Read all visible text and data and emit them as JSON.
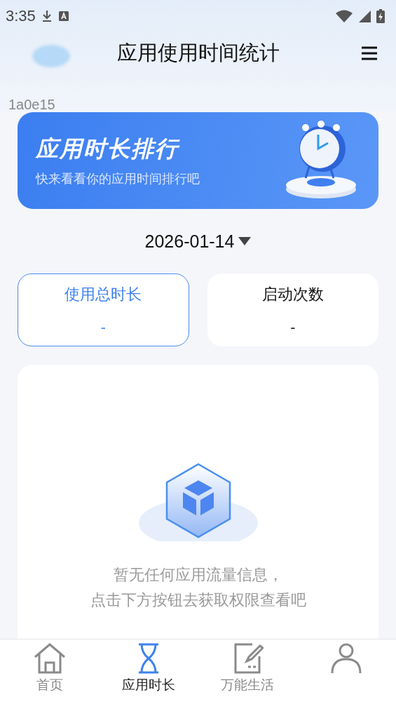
{
  "status_bar": {
    "time": "3:35"
  },
  "header": {
    "title": "应用使用时间统计",
    "debug_label": "1a0e15"
  },
  "banner": {
    "title": "应用时长排行",
    "subtitle": "快来看看你的应用时间排行吧"
  },
  "date": {
    "value": "2026-01-14"
  },
  "stat_tabs": [
    {
      "label": "使用总时长",
      "value": "-",
      "selected": true
    },
    {
      "label": "启动次数",
      "value": "-",
      "selected": false
    }
  ],
  "empty_state": {
    "lines": [
      "暂无任何应用流量信息，",
      "点击下方按钮去获取权限查看吧"
    ]
  },
  "bottom_nav": [
    {
      "label": "首页",
      "selected": false
    },
    {
      "label": "应用时长",
      "selected": true
    },
    {
      "label": "万能生活",
      "selected": false
    },
    {
      "selected": false
    }
  ]
}
